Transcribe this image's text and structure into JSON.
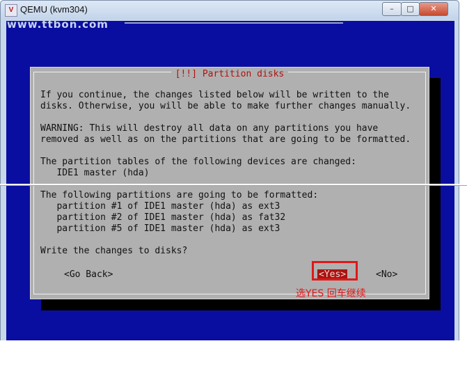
{
  "window": {
    "icon": "V",
    "title": "QEMU (kvm304)"
  },
  "watermark": "www.ttbon.com",
  "dialog": {
    "title": "[!!] Partition disks",
    "lines": [
      "If you continue, the changes listed below will be written to the",
      "disks. Otherwise, you will be able to make further changes manually.",
      "",
      "WARNING: This will destroy all data on any partitions you have",
      "removed as well as on the partitions that are going to be formatted.",
      "",
      "The partition tables of the following devices are changed:",
      "   IDE1 master (hda)",
      "",
      "The following partitions are going to be formatted:",
      "   partition #1 of IDE1 master (hda) as ext3",
      "   partition #2 of IDE1 master (hda) as fat32",
      "   partition #5 of IDE1 master (hda) as ext3",
      "",
      "Write the changes to disks?"
    ],
    "buttons": {
      "back": "<Go Back>",
      "yes": "<Yes>",
      "no": "<No>"
    }
  },
  "annotation": {
    "text": "选YES 回车继续"
  },
  "colors": {
    "screen_bg": "#0a0ea0",
    "dialog_bg": "#b0b0b0",
    "title_red": "#b01212",
    "highlight": "#a81410",
    "annotation": "#e01818"
  }
}
